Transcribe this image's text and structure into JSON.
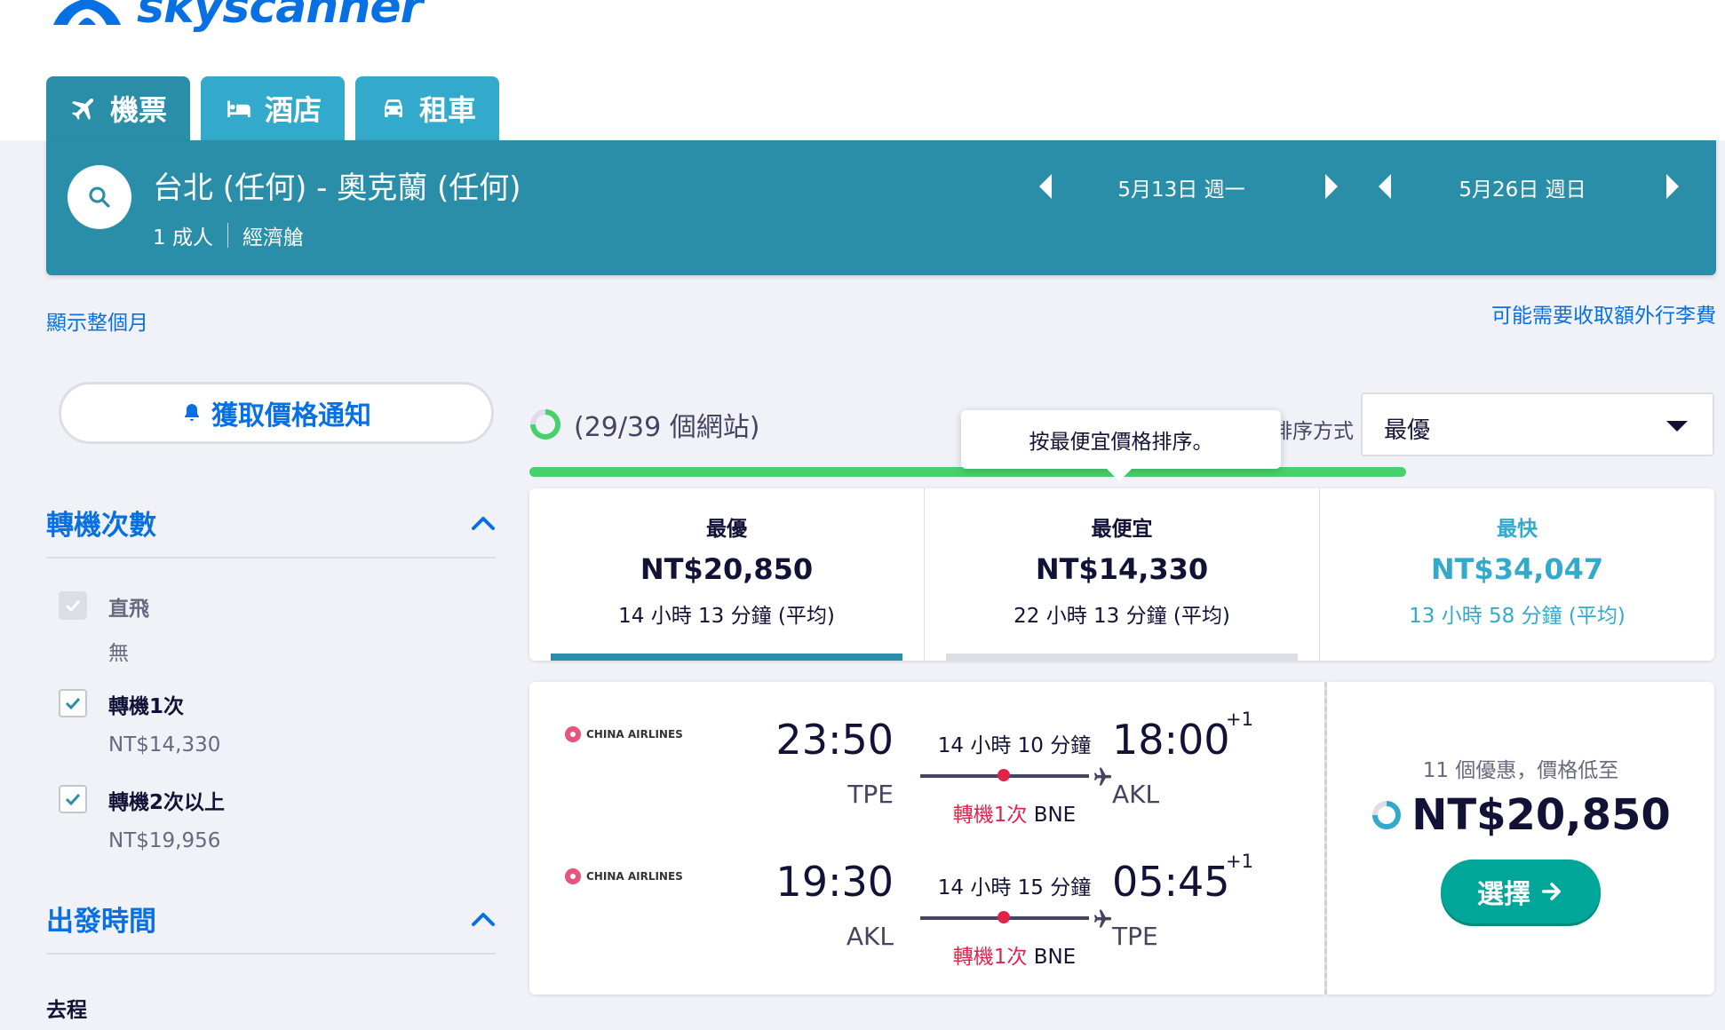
{
  "brand": {
    "name": "skyscanner"
  },
  "tabs": [
    {
      "label": "機票",
      "icon": "plane-icon",
      "active": true
    },
    {
      "label": "酒店",
      "icon": "bed-icon",
      "active": false
    },
    {
      "label": "租車",
      "icon": "car-icon",
      "active": false
    }
  ],
  "search": {
    "route": "台北 (任何) - 奧克蘭 (任何)",
    "passengers": "1 成人",
    "cabin": "經濟艙",
    "depart_date": "5月13日 週一",
    "return_date": "5月26日 週日"
  },
  "links": {
    "show_month": "顯示整個月",
    "baggage_fees": "可能需要收取額外行李費"
  },
  "price_alert": {
    "label": "獲取價格通知"
  },
  "filters": {
    "stops": {
      "title": "轉機次數",
      "options": [
        {
          "label": "直飛",
          "sub": "無",
          "checked": true,
          "disabled": true
        },
        {
          "label": "轉機1次",
          "sub": "NT$14,330",
          "checked": true,
          "disabled": false
        },
        {
          "label": "轉機2次以上",
          "sub": "NT$19,956",
          "checked": true,
          "disabled": false
        }
      ]
    },
    "departure_time": {
      "title": "出發時間",
      "outbound_label": "去程"
    }
  },
  "progress": {
    "text": "(29/39 個網站)",
    "fraction": 0.74
  },
  "sort": {
    "label": "排序方式",
    "selected": "最優",
    "tooltip": "按最便宜價格排序。"
  },
  "sort_tabs": [
    {
      "title": "最優",
      "price": "NT$20,850",
      "duration": "14 小時 13 分鐘 (平均)",
      "color": "#111236",
      "underline": "#2b8ea8"
    },
    {
      "title": "最便宜",
      "price": "NT$14,330",
      "duration": "22 小時 13 分鐘 (平均)",
      "color": "#111236",
      "underline": "#dddde5"
    },
    {
      "title": "最快",
      "price": "NT$34,047",
      "duration": "13 小時 58 分鐘 (平均)",
      "color": "#33aacc",
      "underline": ""
    }
  ],
  "result": {
    "airline": "CHINA AIRLINES",
    "legs": [
      {
        "dep_time": "23:50",
        "dep_code": "TPE",
        "duration": "14 小時 10 分鐘",
        "stops": "轉機1次",
        "via": "BNE",
        "arr_time": "18:00",
        "arr_day": "+1",
        "arr_code": "AKL"
      },
      {
        "dep_time": "19:30",
        "dep_code": "AKL",
        "duration": "14 小時 15 分鐘",
        "stops": "轉機1次",
        "via": "BNE",
        "arr_time": "05:45",
        "arr_day": "+1",
        "arr_code": "TPE"
      }
    ],
    "deals_text": "11 個優惠，價格低至",
    "price": "NT$20,850",
    "select_label": "選擇"
  },
  "colors": {
    "primary": "#0770e3",
    "search_bg": "#2b8ea8",
    "tab": "#33aacc",
    "select": "#00a698",
    "stop_red": "#e0234a",
    "progress": "#47d16c"
  }
}
